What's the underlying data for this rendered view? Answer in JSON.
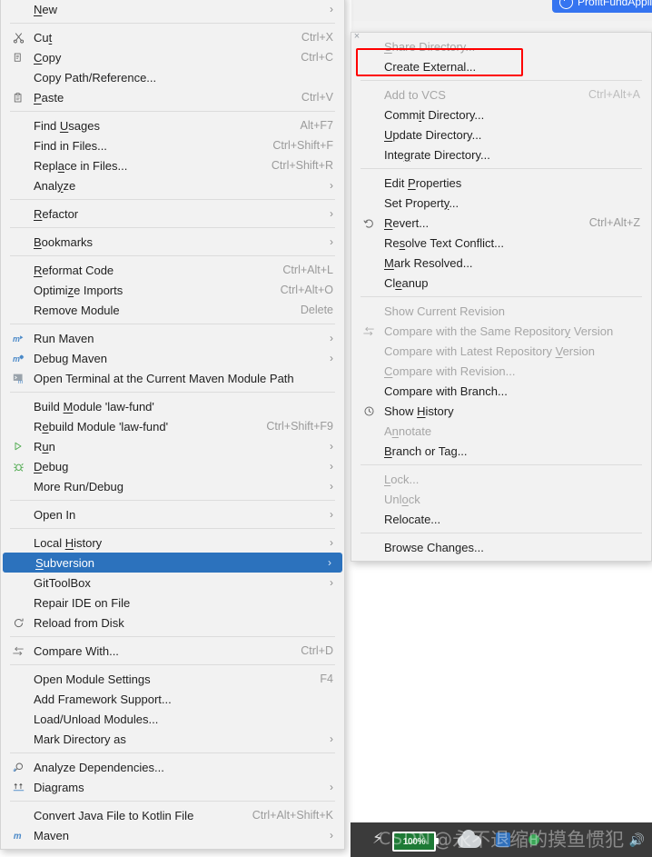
{
  "window": {
    "run_button_label": "ProfitFundAppli",
    "run_button_icon": "run-with-coverage-icon",
    "submenu_close_icon": "×"
  },
  "context_menu": {
    "name": "project-context-menu",
    "items": [
      {
        "type": "item",
        "label": "New",
        "accel": "",
        "arrow": "›",
        "icon": "",
        "mnemonic": "N",
        "disabled": false
      },
      {
        "type": "sep"
      },
      {
        "type": "item",
        "label": "Cut",
        "accel": "Ctrl+X",
        "arrow": "",
        "icon": "scissors-icon",
        "mnemonic": "t",
        "disabled": false
      },
      {
        "type": "item",
        "label": "Copy",
        "accel": "Ctrl+C",
        "arrow": "",
        "icon": "copy-icon",
        "mnemonic": "C",
        "disabled": false
      },
      {
        "type": "item",
        "label": "Copy Path/Reference...",
        "accel": "",
        "arrow": "",
        "icon": "",
        "mnemonic": "",
        "disabled": false
      },
      {
        "type": "item",
        "label": "Paste",
        "accel": "Ctrl+V",
        "arrow": "",
        "icon": "clipboard-icon",
        "mnemonic": "P",
        "disabled": false
      },
      {
        "type": "sep"
      },
      {
        "type": "item",
        "label": "Find Usages",
        "accel": "Alt+F7",
        "arrow": "",
        "icon": "",
        "mnemonic": "U",
        "disabled": false
      },
      {
        "type": "item",
        "label": "Find in Files...",
        "accel": "Ctrl+Shift+F",
        "arrow": "",
        "icon": "",
        "mnemonic": "",
        "disabled": false
      },
      {
        "type": "item",
        "label": "Replace in Files...",
        "accel": "Ctrl+Shift+R",
        "arrow": "",
        "icon": "",
        "mnemonic": "a",
        "disabled": false
      },
      {
        "type": "item",
        "label": "Analyze",
        "accel": "",
        "arrow": "›",
        "icon": "",
        "mnemonic": "y",
        "disabled": false
      },
      {
        "type": "sep"
      },
      {
        "type": "item",
        "label": "Refactor",
        "accel": "",
        "arrow": "›",
        "icon": "",
        "mnemonic": "R",
        "disabled": false
      },
      {
        "type": "sep"
      },
      {
        "type": "item",
        "label": "Bookmarks",
        "accel": "",
        "arrow": "›",
        "icon": "",
        "mnemonic": "B",
        "disabled": false
      },
      {
        "type": "sep"
      },
      {
        "type": "item",
        "label": "Reformat Code",
        "accel": "Ctrl+Alt+L",
        "arrow": "",
        "icon": "",
        "mnemonic": "R",
        "disabled": false
      },
      {
        "type": "item",
        "label": "Optimize Imports",
        "accel": "Ctrl+Alt+O",
        "arrow": "",
        "icon": "",
        "mnemonic": "z",
        "disabled": false
      },
      {
        "type": "item",
        "label": "Remove Module",
        "accel": "Delete",
        "arrow": "",
        "icon": "",
        "mnemonic": "",
        "disabled": false
      },
      {
        "type": "sep"
      },
      {
        "type": "item",
        "label": "Run Maven",
        "accel": "",
        "arrow": "›",
        "icon": "maven-run-icon",
        "mnemonic": "",
        "disabled": false
      },
      {
        "type": "item",
        "label": "Debug Maven",
        "accel": "",
        "arrow": "›",
        "icon": "maven-debug-icon",
        "mnemonic": "",
        "disabled": false
      },
      {
        "type": "item",
        "label": "Open Terminal at the Current Maven Module Path",
        "accel": "",
        "arrow": "",
        "icon": "terminal-icon",
        "mnemonic": "",
        "disabled": false
      },
      {
        "type": "sep"
      },
      {
        "type": "item",
        "label": "Build Module 'law-fund'",
        "accel": "",
        "arrow": "",
        "icon": "",
        "mnemonic": "M",
        "disabled": false
      },
      {
        "type": "item",
        "label": "Rebuild Module 'law-fund'",
        "accel": "Ctrl+Shift+F9",
        "arrow": "",
        "icon": "",
        "mnemonic": "e",
        "disabled": false
      },
      {
        "type": "item",
        "label": "Run",
        "accel": "",
        "arrow": "›",
        "icon": "run-icon",
        "mnemonic": "u",
        "disabled": false
      },
      {
        "type": "item",
        "label": "Debug",
        "accel": "",
        "arrow": "›",
        "icon": "debug-icon",
        "mnemonic": "D",
        "disabled": false
      },
      {
        "type": "item",
        "label": "More Run/Debug",
        "accel": "",
        "arrow": "›",
        "icon": "",
        "mnemonic": "",
        "disabled": false
      },
      {
        "type": "sep"
      },
      {
        "type": "item",
        "label": "Open In",
        "accel": "",
        "arrow": "›",
        "icon": "",
        "mnemonic": "",
        "disabled": false
      },
      {
        "type": "sep"
      },
      {
        "type": "item",
        "label": "Local History",
        "accel": "",
        "arrow": "›",
        "icon": "",
        "mnemonic": "H",
        "disabled": false
      },
      {
        "type": "item",
        "label": "Subversion",
        "accel": "",
        "arrow": "›",
        "icon": "",
        "mnemonic": "S",
        "disabled": false,
        "selected": true
      },
      {
        "type": "item",
        "label": "GitToolBox",
        "accel": "",
        "arrow": "›",
        "icon": "",
        "mnemonic": "",
        "disabled": false
      },
      {
        "type": "item",
        "label": "Repair IDE on File",
        "accel": "",
        "arrow": "",
        "icon": "",
        "mnemonic": "",
        "disabled": false
      },
      {
        "type": "item",
        "label": "Reload from Disk",
        "accel": "",
        "arrow": "",
        "icon": "reload-icon",
        "mnemonic": "",
        "disabled": false
      },
      {
        "type": "sep"
      },
      {
        "type": "item",
        "label": "Compare With...",
        "accel": "Ctrl+D",
        "arrow": "",
        "icon": "compare-icon",
        "mnemonic": "",
        "disabled": false
      },
      {
        "type": "sep"
      },
      {
        "type": "item",
        "label": "Open Module Settings",
        "accel": "F4",
        "arrow": "",
        "icon": "",
        "mnemonic": "",
        "disabled": false
      },
      {
        "type": "item",
        "label": "Add Framework Support...",
        "accel": "",
        "arrow": "",
        "icon": "",
        "mnemonic": "",
        "disabled": false
      },
      {
        "type": "item",
        "label": "Load/Unload Modules...",
        "accel": "",
        "arrow": "",
        "icon": "",
        "mnemonic": "",
        "disabled": false
      },
      {
        "type": "item",
        "label": "Mark Directory as",
        "accel": "",
        "arrow": "›",
        "icon": "",
        "mnemonic": "",
        "disabled": false
      },
      {
        "type": "sep"
      },
      {
        "type": "item",
        "label": "Analyze Dependencies...",
        "accel": "",
        "arrow": "",
        "icon": "analyze-dependencies-icon",
        "mnemonic": "",
        "disabled": false
      },
      {
        "type": "item",
        "label": "Diagrams",
        "accel": "",
        "arrow": "›",
        "icon": "diagram-icon",
        "mnemonic": "",
        "disabled": false
      },
      {
        "type": "sep"
      },
      {
        "type": "item",
        "label": "Convert Java File to Kotlin File",
        "accel": "Ctrl+Alt+Shift+K",
        "arrow": "",
        "icon": "",
        "mnemonic": "",
        "disabled": false
      },
      {
        "type": "item",
        "label": "Maven",
        "accel": "",
        "arrow": "›",
        "icon": "maven-icon",
        "mnemonic": "",
        "disabled": false
      }
    ]
  },
  "svn_submenu": {
    "name": "subversion-submenu",
    "items": [
      {
        "type": "item",
        "label": "Share Directory...",
        "accel": "",
        "arrow": "",
        "icon": "",
        "mnemonic": "S",
        "disabled": true,
        "annotated": true
      },
      {
        "type": "item",
        "label": "Create External...",
        "accel": "",
        "arrow": "",
        "icon": "",
        "mnemonic": "",
        "disabled": false
      },
      {
        "type": "sep"
      },
      {
        "type": "item",
        "label": "Add to VCS",
        "accel": "Ctrl+Alt+A",
        "arrow": "",
        "icon": "",
        "mnemonic": "",
        "disabled": true
      },
      {
        "type": "item",
        "label": "Commit Directory...",
        "accel": "",
        "arrow": "",
        "icon": "",
        "mnemonic": "i",
        "disabled": false
      },
      {
        "type": "item",
        "label": "Update Directory...",
        "accel": "",
        "arrow": "",
        "icon": "",
        "mnemonic": "U",
        "disabled": false
      },
      {
        "type": "item",
        "label": "Integrate Directory...",
        "accel": "",
        "arrow": "",
        "icon": "",
        "mnemonic": "g",
        "disabled": false
      },
      {
        "type": "sep"
      },
      {
        "type": "item",
        "label": "Edit Properties",
        "accel": "",
        "arrow": "",
        "icon": "",
        "mnemonic": "P",
        "disabled": false
      },
      {
        "type": "item",
        "label": "Set Property...",
        "accel": "",
        "arrow": "",
        "icon": "",
        "mnemonic": "y",
        "disabled": false
      },
      {
        "type": "item",
        "label": "Revert...",
        "accel": "Ctrl+Alt+Z",
        "arrow": "",
        "icon": "revert-icon",
        "mnemonic": "R",
        "disabled": false
      },
      {
        "type": "item",
        "label": "Resolve Text Conflict...",
        "accel": "",
        "arrow": "",
        "icon": "",
        "mnemonic": "s",
        "disabled": false
      },
      {
        "type": "item",
        "label": "Mark Resolved...",
        "accel": "",
        "arrow": "",
        "icon": "",
        "mnemonic": "M",
        "disabled": false
      },
      {
        "type": "item",
        "label": "Cleanup",
        "accel": "",
        "arrow": "",
        "icon": "",
        "mnemonic": "e",
        "disabled": false
      },
      {
        "type": "sep"
      },
      {
        "type": "item",
        "label": "Show Current Revision",
        "accel": "",
        "arrow": "",
        "icon": "",
        "mnemonic": "",
        "disabled": true
      },
      {
        "type": "item",
        "label": "Compare with the Same Repository Version",
        "accel": "",
        "arrow": "",
        "icon": "compare-icon",
        "mnemonic": "y",
        "disabled": true
      },
      {
        "type": "item",
        "label": "Compare with Latest Repository Version",
        "accel": "",
        "arrow": "",
        "icon": "",
        "mnemonic": "V",
        "disabled": true
      },
      {
        "type": "item",
        "label": "Compare with Revision...",
        "accel": "",
        "arrow": "",
        "icon": "",
        "mnemonic": "C",
        "disabled": true
      },
      {
        "type": "item",
        "label": "Compare with Branch...",
        "accel": "",
        "arrow": "",
        "icon": "",
        "mnemonic": "",
        "disabled": false
      },
      {
        "type": "item",
        "label": "Show History",
        "accel": "",
        "arrow": "",
        "icon": "history-icon",
        "mnemonic": "H",
        "disabled": false
      },
      {
        "type": "item",
        "label": "Annotate",
        "accel": "",
        "arrow": "",
        "icon": "",
        "mnemonic": "n",
        "disabled": true
      },
      {
        "type": "item",
        "label": "Branch or Tag...",
        "accel": "",
        "arrow": "",
        "icon": "",
        "mnemonic": "B",
        "disabled": false
      },
      {
        "type": "sep"
      },
      {
        "type": "item",
        "label": "Lock...",
        "accel": "",
        "arrow": "",
        "icon": "",
        "mnemonic": "L",
        "disabled": true
      },
      {
        "type": "item",
        "label": "Unlock",
        "accel": "",
        "arrow": "",
        "icon": "",
        "mnemonic": "o",
        "disabled": true
      },
      {
        "type": "item",
        "label": "Relocate...",
        "accel": "",
        "arrow": "",
        "icon": "",
        "mnemonic": "",
        "disabled": false
      },
      {
        "type": "sep"
      },
      {
        "type": "item",
        "label": "Browse Changes...",
        "accel": "",
        "arrow": "",
        "icon": "",
        "mnemonic": "",
        "disabled": false
      }
    ]
  },
  "taskbar": {
    "battery_percent": "100%",
    "battery_icon": "battery-icon",
    "charging_icon": "lightning-bolt-icon",
    "cloud_icon": "cloud-icon",
    "ime_icon": "ime-indicator-icon",
    "status_dot_icon": "green-status-dot-icon",
    "speaker_icon": "speaker-icon"
  },
  "watermark": {
    "brand": "CSDN",
    "author": "@永不退缩的摸鱼惯犯"
  },
  "colors": {
    "menu_bg": "#f2f2f2",
    "menu_border": "#d4d4d4",
    "selection_blue": "#2c72bd",
    "accent_button_blue": "#3574f0",
    "annotation_red": "#ff0000",
    "disabled_text": "#a6a6a6",
    "accel_text": "#9a9a9a",
    "taskbar_bg": "#3b3b3b",
    "battery_green": "#1d7a35"
  }
}
